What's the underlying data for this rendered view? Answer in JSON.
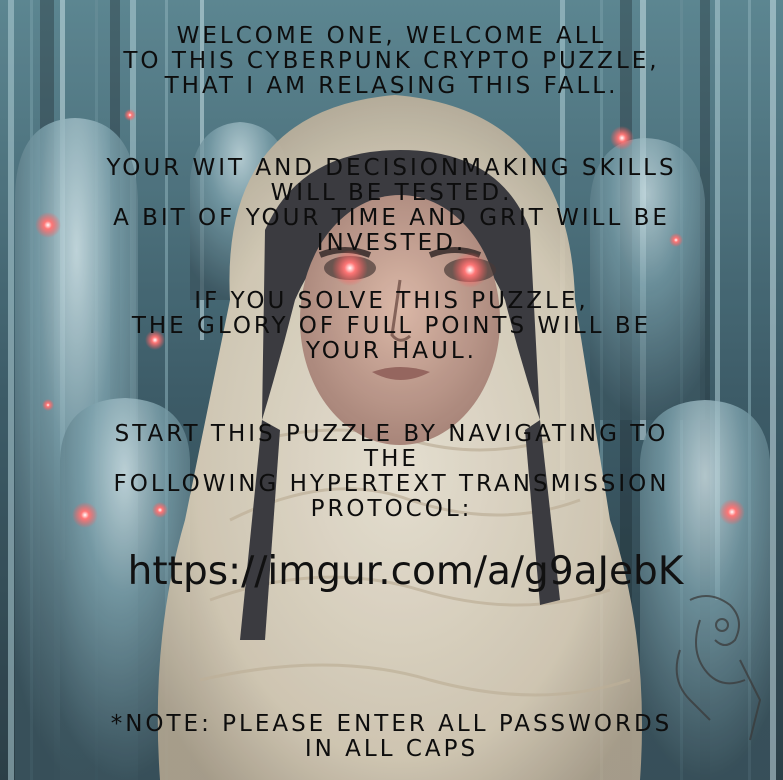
{
  "message": {
    "paragraph_1": "Welcome one, welcome all\nto this cyberpunk crypto puzzle,\nthat I am relasing this fall.",
    "paragraph_2": "Your wit and decisionmaking skills\nwill be tested.\nA bit of your time and grit will be\ninvested.",
    "paragraph_3": "If you solve this puzzle,\nthe glory of full points will be\nyour haul.",
    "paragraph_4": "Start this puzzle by navigating to\nthe\nfollowing hypertext transmission\nprotocol:",
    "url": "https://imgur.com/a/g9aJebK",
    "note": "*Note: Please enter all passwords\nin all caps"
  },
  "artwork": {
    "subject": "portrait-illustration",
    "palette": {
      "background_dark": "#0e1a22",
      "rain_teal": "#3f6d7a",
      "rain_light": "#9fc3cb",
      "hood_cream": "#e8dcc6",
      "skin": "#c49a86",
      "glow_red": "#ff4a4a",
      "text": "#0d0d0d"
    }
  }
}
